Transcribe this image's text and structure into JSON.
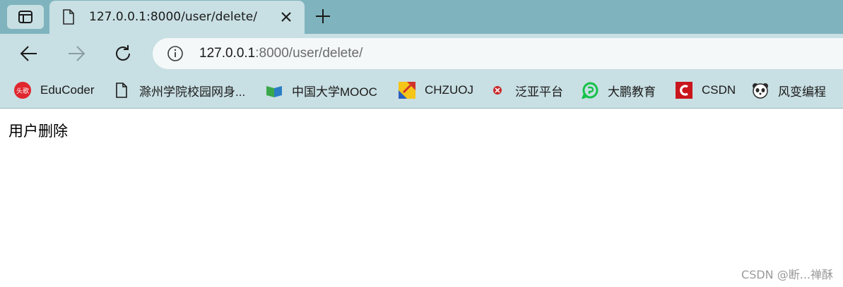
{
  "tab": {
    "title": "127.0.0.1:8000/user/delete/"
  },
  "address": {
    "host": "127.0.0.1",
    "path": ":8000/user/delete/"
  },
  "bookmarks": [
    {
      "label": "EduCoder",
      "icon": "toutiao-icon"
    },
    {
      "label": "滁州学院校园网身...",
      "icon": "page-icon"
    },
    {
      "label": "中国大学MOOC",
      "icon": "mooc-icon"
    },
    {
      "label": "CHZUOJ",
      "icon": "chzuoj-icon"
    },
    {
      "label": "泛亚平台",
      "icon": "fanya-icon"
    },
    {
      "label": "大鹏教育",
      "icon": "dapeng-icon"
    },
    {
      "label": "CSDN",
      "icon": "csdn-icon"
    },
    {
      "label": "风变编程",
      "icon": "panda-icon"
    }
  ],
  "icon_badge_text": "头歌",
  "page": {
    "text": "用户删除"
  },
  "watermark": "CSDN @断...禅酥",
  "colors": {
    "tabstrip": "#7fb4be",
    "toolbar": "#c8dfe3",
    "address_bg": "#f4f8f9"
  }
}
